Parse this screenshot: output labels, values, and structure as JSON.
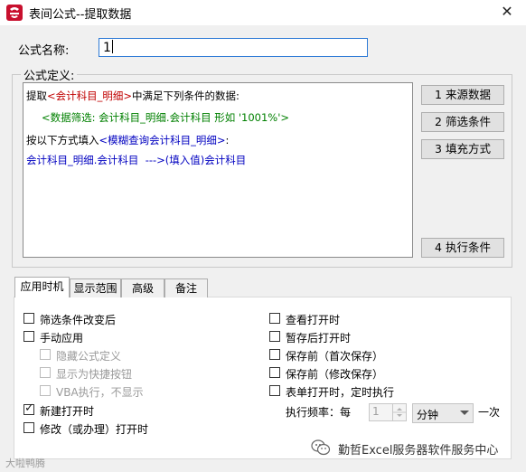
{
  "window": {
    "title": "表间公式--提取数据",
    "close": "✕"
  },
  "name_field": {
    "label": "公式名称:",
    "value": "1"
  },
  "definition": {
    "legend": "公式定义:",
    "line1": {
      "p1": "提取",
      "p2": "<会计科目_明细>",
      "p3": "中满足下列条件的数据:"
    },
    "line2": "<数据筛选: 会计科目_明细.会计科目 形如 '1001%'>",
    "line3": {
      "p1": "按以下方式填入",
      "p2": "<模糊查询会计科目_明细>",
      "p3": ":"
    },
    "line4": {
      "p1": "会计科目_明细.会计科目",
      "p2": "  --->(填入值)",
      "p3": "会计科目"
    }
  },
  "buttons": {
    "source": "1 来源数据",
    "filter": "2 筛选条件",
    "fill": "3 填充方式",
    "exec": "4 执行条件"
  },
  "tabs": [
    "应用时机",
    "显示范围",
    "高级",
    "备注"
  ],
  "left_options": [
    {
      "label": "筛选条件改变后",
      "checked": false,
      "disabled": false
    },
    {
      "label": "手动应用",
      "checked": false,
      "disabled": false
    },
    {
      "label": "隐藏公式定义",
      "checked": false,
      "disabled": true
    },
    {
      "label": "显示为快捷按钮",
      "checked": false,
      "disabled": true
    },
    {
      "label": "VBA执行，不显示",
      "checked": false,
      "disabled": true
    },
    {
      "label": "新建打开时",
      "checked": true,
      "disabled": false
    },
    {
      "label": "修改（或办理）打开时",
      "checked": false,
      "disabled": false
    }
  ],
  "right_options": [
    {
      "label": "查看打开时",
      "checked": false
    },
    {
      "label": "暂存后打开时",
      "checked": false
    },
    {
      "label": "保存前（首次保存）",
      "checked": false
    },
    {
      "label": "保存前（修改保存）",
      "checked": false
    },
    {
      "label": "表单打开时，定时执行",
      "checked": false
    }
  ],
  "frequency": {
    "label": "执行频率：每",
    "value": "1",
    "unit": "分钟",
    "suffix": "一次"
  },
  "watermark": {
    "left": "大啦鸭腾",
    "right": "勤哲Excel服务器软件服务中心"
  },
  "colors": {
    "red": "#c00000",
    "green": "#008000",
    "blue": "#0000c0",
    "accent": "#2f7bd6"
  }
}
